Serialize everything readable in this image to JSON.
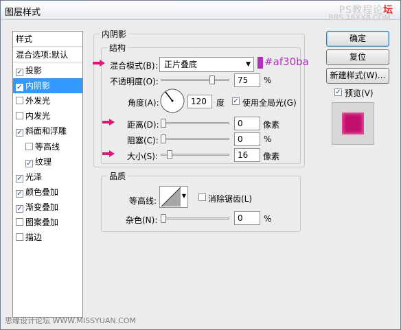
{
  "window": {
    "title": "图层样式",
    "watermark_top_prefix": "PS教程论",
    "watermark_top_red": "坛",
    "watermark_top_line2": "BBS.16XX8.COM",
    "watermark_bottom": "思缘设计论坛 WWW.MISSYUAN.COM"
  },
  "style_list": {
    "header": "样式",
    "blend_options": "混合选项:默认",
    "items": [
      {
        "label": "投影",
        "checked": true
      },
      {
        "label": "内阴影",
        "checked": true,
        "selected": true
      },
      {
        "label": "外发光",
        "checked": false
      },
      {
        "label": "内发光",
        "checked": false
      },
      {
        "label": "斜面和浮雕",
        "checked": true
      },
      {
        "label": "等高线",
        "checked": false,
        "indent": true
      },
      {
        "label": "纹理",
        "checked": true,
        "indent": true
      },
      {
        "label": "光泽",
        "checked": true
      },
      {
        "label": "颜色叠加",
        "checked": true
      },
      {
        "label": "渐变叠加",
        "checked": true
      },
      {
        "label": "图案叠加",
        "checked": false
      },
      {
        "label": "描边",
        "checked": false
      }
    ]
  },
  "inner_shadow": {
    "section_title": "内阴影",
    "structure_title": "结构",
    "blend_mode_label": "混合模式(B):",
    "blend_mode_value": "正片叠底",
    "color_hex": "#af30ba",
    "opacity_label": "不透明度(O):",
    "opacity_value": "75",
    "opacity_unit": "%",
    "angle_label": "角度(A):",
    "angle_value": "120",
    "angle_unit": "度",
    "global_light_label": "使用全局光(G)",
    "global_light_checked": true,
    "distance_label": "距离(D):",
    "distance_value": "0",
    "distance_unit": "像素",
    "choke_label": "阻塞(C):",
    "choke_value": "0",
    "choke_unit": "%",
    "size_label": "大小(S):",
    "size_value": "16",
    "size_unit": "像素",
    "quality_title": "品质",
    "contour_label": "等高线:",
    "anti_alias_label": "消除锯齿(L)",
    "anti_alias_checked": false,
    "noise_label": "杂色(N):",
    "noise_value": "0",
    "noise_unit": "%"
  },
  "buttons": {
    "ok": "确定",
    "reset": "复位",
    "new_style": "新建样式(W)...",
    "preview_label": "预览(V)",
    "preview_checked": true
  },
  "colors": {
    "accent": "#af30ba",
    "selection": "#3399ff",
    "preview_fill": "#c20f6c",
    "annotation_arrow": "#e4157a"
  }
}
